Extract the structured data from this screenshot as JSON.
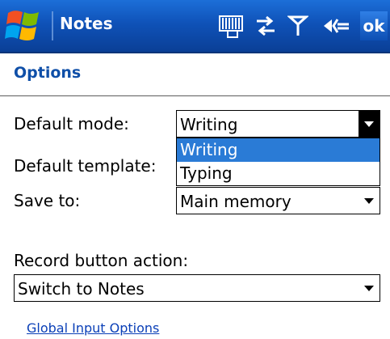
{
  "titlebar": {
    "app_title": "Notes",
    "start_icon": "windows-flag-icon",
    "tray_icons": [
      "keyboard-icon",
      "connectivity-icon",
      "signal-icon",
      "volume-icon"
    ],
    "ok_label": "ok"
  },
  "header": {
    "title": "Options"
  },
  "form": {
    "default_mode": {
      "label": "Default mode:",
      "value": "Writing",
      "options": [
        "Writing",
        "Typing"
      ],
      "highlighted_option": "Writing",
      "expanded": true
    },
    "default_template": {
      "label": "Default template:"
    },
    "save_to": {
      "label": "Save to:",
      "value": "Main memory"
    },
    "record_button": {
      "label": "Record button action:",
      "value": "Switch to Notes"
    }
  },
  "links": {
    "global_input": "Global Input Options"
  },
  "colors": {
    "titlebar": "#0f52b8",
    "header_text": "#0f4fa8",
    "highlight": "#2a7bd6",
    "link": "#0a3fb7"
  }
}
